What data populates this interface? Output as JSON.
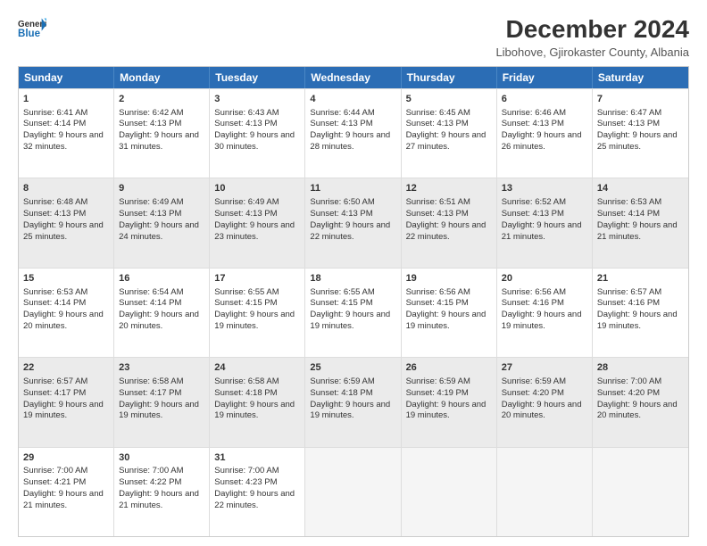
{
  "logo": {
    "general": "General",
    "blue": "Blue"
  },
  "title": "December 2024",
  "subtitle": "Libohove, Gjirokaster County, Albania",
  "days": [
    "Sunday",
    "Monday",
    "Tuesday",
    "Wednesday",
    "Thursday",
    "Friday",
    "Saturday"
  ],
  "weeks": [
    [
      {
        "day": "1",
        "sunrise": "Sunrise: 6:41 AM",
        "sunset": "Sunset: 4:14 PM",
        "daylight": "Daylight: 9 hours and 32 minutes.",
        "shaded": false
      },
      {
        "day": "2",
        "sunrise": "Sunrise: 6:42 AM",
        "sunset": "Sunset: 4:13 PM",
        "daylight": "Daylight: 9 hours and 31 minutes.",
        "shaded": false
      },
      {
        "day": "3",
        "sunrise": "Sunrise: 6:43 AM",
        "sunset": "Sunset: 4:13 PM",
        "daylight": "Daylight: 9 hours and 30 minutes.",
        "shaded": false
      },
      {
        "day": "4",
        "sunrise": "Sunrise: 6:44 AM",
        "sunset": "Sunset: 4:13 PM",
        "daylight": "Daylight: 9 hours and 28 minutes.",
        "shaded": false
      },
      {
        "day": "5",
        "sunrise": "Sunrise: 6:45 AM",
        "sunset": "Sunset: 4:13 PM",
        "daylight": "Daylight: 9 hours and 27 minutes.",
        "shaded": false
      },
      {
        "day": "6",
        "sunrise": "Sunrise: 6:46 AM",
        "sunset": "Sunset: 4:13 PM",
        "daylight": "Daylight: 9 hours and 26 minutes.",
        "shaded": false
      },
      {
        "day": "7",
        "sunrise": "Sunrise: 6:47 AM",
        "sunset": "Sunset: 4:13 PM",
        "daylight": "Daylight: 9 hours and 25 minutes.",
        "shaded": false
      }
    ],
    [
      {
        "day": "8",
        "sunrise": "Sunrise: 6:48 AM",
        "sunset": "Sunset: 4:13 PM",
        "daylight": "Daylight: 9 hours and 25 minutes.",
        "shaded": true
      },
      {
        "day": "9",
        "sunrise": "Sunrise: 6:49 AM",
        "sunset": "Sunset: 4:13 PM",
        "daylight": "Daylight: 9 hours and 24 minutes.",
        "shaded": true
      },
      {
        "day": "10",
        "sunrise": "Sunrise: 6:49 AM",
        "sunset": "Sunset: 4:13 PM",
        "daylight": "Daylight: 9 hours and 23 minutes.",
        "shaded": true
      },
      {
        "day": "11",
        "sunrise": "Sunrise: 6:50 AM",
        "sunset": "Sunset: 4:13 PM",
        "daylight": "Daylight: 9 hours and 22 minutes.",
        "shaded": true
      },
      {
        "day": "12",
        "sunrise": "Sunrise: 6:51 AM",
        "sunset": "Sunset: 4:13 PM",
        "daylight": "Daylight: 9 hours and 22 minutes.",
        "shaded": true
      },
      {
        "day": "13",
        "sunrise": "Sunrise: 6:52 AM",
        "sunset": "Sunset: 4:13 PM",
        "daylight": "Daylight: 9 hours and 21 minutes.",
        "shaded": true
      },
      {
        "day": "14",
        "sunrise": "Sunrise: 6:53 AM",
        "sunset": "Sunset: 4:14 PM",
        "daylight": "Daylight: 9 hours and 21 minutes.",
        "shaded": true
      }
    ],
    [
      {
        "day": "15",
        "sunrise": "Sunrise: 6:53 AM",
        "sunset": "Sunset: 4:14 PM",
        "daylight": "Daylight: 9 hours and 20 minutes.",
        "shaded": false
      },
      {
        "day": "16",
        "sunrise": "Sunrise: 6:54 AM",
        "sunset": "Sunset: 4:14 PM",
        "daylight": "Daylight: 9 hours and 20 minutes.",
        "shaded": false
      },
      {
        "day": "17",
        "sunrise": "Sunrise: 6:55 AM",
        "sunset": "Sunset: 4:15 PM",
        "daylight": "Daylight: 9 hours and 19 minutes.",
        "shaded": false
      },
      {
        "day": "18",
        "sunrise": "Sunrise: 6:55 AM",
        "sunset": "Sunset: 4:15 PM",
        "daylight": "Daylight: 9 hours and 19 minutes.",
        "shaded": false
      },
      {
        "day": "19",
        "sunrise": "Sunrise: 6:56 AM",
        "sunset": "Sunset: 4:15 PM",
        "daylight": "Daylight: 9 hours and 19 minutes.",
        "shaded": false
      },
      {
        "day": "20",
        "sunrise": "Sunrise: 6:56 AM",
        "sunset": "Sunset: 4:16 PM",
        "daylight": "Daylight: 9 hours and 19 minutes.",
        "shaded": false
      },
      {
        "day": "21",
        "sunrise": "Sunrise: 6:57 AM",
        "sunset": "Sunset: 4:16 PM",
        "daylight": "Daylight: 9 hours and 19 minutes.",
        "shaded": false
      }
    ],
    [
      {
        "day": "22",
        "sunrise": "Sunrise: 6:57 AM",
        "sunset": "Sunset: 4:17 PM",
        "daylight": "Daylight: 9 hours and 19 minutes.",
        "shaded": true
      },
      {
        "day": "23",
        "sunrise": "Sunrise: 6:58 AM",
        "sunset": "Sunset: 4:17 PM",
        "daylight": "Daylight: 9 hours and 19 minutes.",
        "shaded": true
      },
      {
        "day": "24",
        "sunrise": "Sunrise: 6:58 AM",
        "sunset": "Sunset: 4:18 PM",
        "daylight": "Daylight: 9 hours and 19 minutes.",
        "shaded": true
      },
      {
        "day": "25",
        "sunrise": "Sunrise: 6:59 AM",
        "sunset": "Sunset: 4:18 PM",
        "daylight": "Daylight: 9 hours and 19 minutes.",
        "shaded": true
      },
      {
        "day": "26",
        "sunrise": "Sunrise: 6:59 AM",
        "sunset": "Sunset: 4:19 PM",
        "daylight": "Daylight: 9 hours and 19 minutes.",
        "shaded": true
      },
      {
        "day": "27",
        "sunrise": "Sunrise: 6:59 AM",
        "sunset": "Sunset: 4:20 PM",
        "daylight": "Daylight: 9 hours and 20 minutes.",
        "shaded": true
      },
      {
        "day": "28",
        "sunrise": "Sunrise: 7:00 AM",
        "sunset": "Sunset: 4:20 PM",
        "daylight": "Daylight: 9 hours and 20 minutes.",
        "shaded": true
      }
    ],
    [
      {
        "day": "29",
        "sunrise": "Sunrise: 7:00 AM",
        "sunset": "Sunset: 4:21 PM",
        "daylight": "Daylight: 9 hours and 21 minutes.",
        "shaded": false
      },
      {
        "day": "30",
        "sunrise": "Sunrise: 7:00 AM",
        "sunset": "Sunset: 4:22 PM",
        "daylight": "Daylight: 9 hours and 21 minutes.",
        "shaded": false
      },
      {
        "day": "31",
        "sunrise": "Sunrise: 7:00 AM",
        "sunset": "Sunset: 4:23 PM",
        "daylight": "Daylight: 9 hours and 22 minutes.",
        "shaded": false
      },
      {
        "day": "",
        "sunrise": "",
        "sunset": "",
        "daylight": "",
        "shaded": false,
        "empty": true
      },
      {
        "day": "",
        "sunrise": "",
        "sunset": "",
        "daylight": "",
        "shaded": false,
        "empty": true
      },
      {
        "day": "",
        "sunrise": "",
        "sunset": "",
        "daylight": "",
        "shaded": false,
        "empty": true
      },
      {
        "day": "",
        "sunrise": "",
        "sunset": "",
        "daylight": "",
        "shaded": false,
        "empty": true
      }
    ]
  ]
}
